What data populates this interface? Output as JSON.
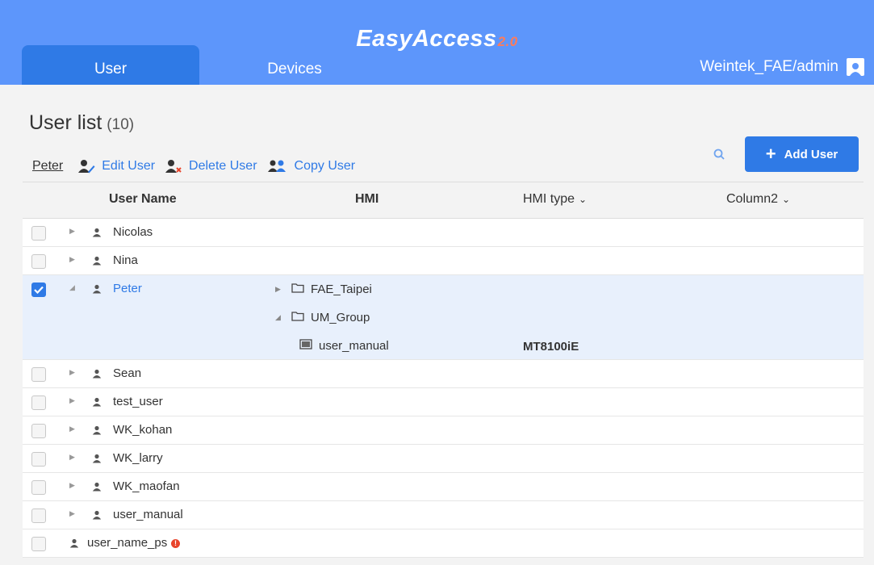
{
  "header": {
    "logo_text": "EasyAccess",
    "logo_version": "2.0",
    "tabs": [
      "User",
      "Devices"
    ],
    "active_tab": "User",
    "account": "Weintek_FAE/admin"
  },
  "page": {
    "title": "User list",
    "count": "(10)"
  },
  "toolbar": {
    "selected_user": "Peter",
    "edit_label": "Edit User",
    "delete_label": "Delete User",
    "copy_label": "Copy User",
    "add_label": "Add User"
  },
  "table": {
    "columns": [
      "User Name",
      "HMI",
      "HMI type",
      "Column2"
    ],
    "rows": [
      {
        "name": "Nicolas",
        "checked": false
      },
      {
        "name": "Nina",
        "checked": false
      },
      {
        "name": "Peter",
        "checked": true,
        "expanded": true
      },
      {
        "name": "Sean",
        "checked": false
      },
      {
        "name": "test_user",
        "checked": false
      },
      {
        "name": "WK_kohan",
        "checked": false
      },
      {
        "name": "WK_larry",
        "checked": false
      },
      {
        "name": "WK_maofan",
        "checked": false
      },
      {
        "name": "user_manual",
        "checked": false
      },
      {
        "name": "user_name_ps",
        "checked": false,
        "warning": true
      }
    ],
    "peter_children": {
      "group1": "FAE_Taipei",
      "group2": "UM_Group",
      "hmi": "user_manual",
      "hmi_type": "MT8100iE"
    }
  },
  "colors": {
    "header_bg": "#5d96fb",
    "accent": "#2f7ae6",
    "warning": "#e8442b"
  }
}
